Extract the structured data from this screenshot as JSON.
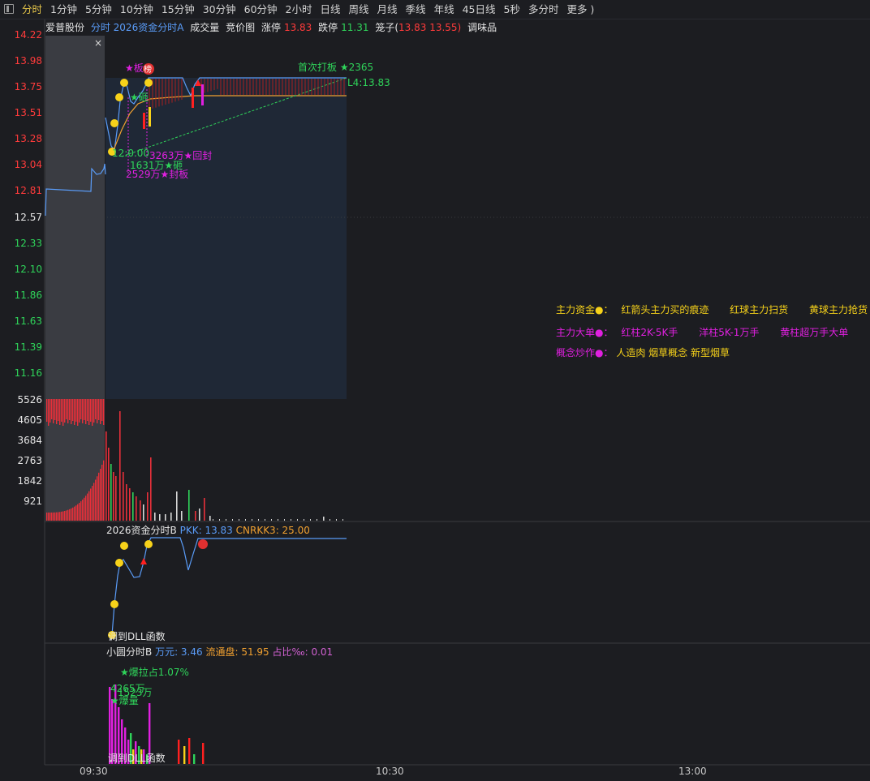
{
  "toolbar": {
    "tabs": [
      "分时",
      "1分钟",
      "5分钟",
      "10分钟",
      "15分钟",
      "30分钟",
      "60分钟",
      "2小时",
      "日线",
      "周线",
      "月线",
      "季线",
      "年线",
      "45日线",
      "5秒",
      "多分时",
      "更多 )"
    ],
    "active_tab": "分时"
  },
  "info": {
    "stock_name": "爱普股份",
    "indicator_a": "分时 2026资金分时A",
    "volume": "成交量",
    "auction": "竞价图",
    "limit_up_label": "涨停",
    "limit_up_value": "13.83",
    "limit_down_label": "跌停",
    "limit_down_value": "11.31",
    "cage_label": "笼子(",
    "cage_value": "13.83 13.55)",
    "taste": "调味品"
  },
  "price_axis": {
    "red_labels": [
      "14.22",
      "13.98",
      "13.75",
      "13.51",
      "13.28",
      "13.04",
      "12.81"
    ],
    "base_label": "12.57",
    "green_labels": [
      "12.33",
      "12.10",
      "11.86",
      "11.63",
      "11.39",
      "11.16"
    ]
  },
  "volume_axis": [
    "5526",
    "4605",
    "3684",
    "2763",
    "1842",
    "921"
  ],
  "annotations": {
    "board": "★板",
    "rank": "榜",
    "smash": "★砸",
    "first_board": "首次打板 ★2365",
    "l4": "L4:13.83",
    "time_mark": "12:0.00",
    "recap": "3263万★回封",
    "smash_amount": "1631万★砸",
    "seal_amount": "2529万★封板",
    "close": "×"
  },
  "legend": {
    "row1_label": "主力资金●：",
    "row1_a": "红箭头主力买的痕迹",
    "row1_b": "红球主力扫货",
    "row1_c": "黄球主力抢货",
    "row2_label": "主力大单●：",
    "row2_a": "红柱2K-5K手",
    "row2_b": "洋柱5K-1万手",
    "row2_c": "黄柱超万手大单",
    "row3_label": "概念炒作●：",
    "row3_a": "人造肉 烟草概念 新型烟草"
  },
  "panel_b": {
    "title": "2026资金分时B",
    "pkk": "PKK: 13.83",
    "cnrkk": "CNRKK3: 25.00",
    "footer": "调到DLL函数"
  },
  "panel_c": {
    "title": "小圆分时B",
    "wan": "万元: 3.46",
    "float": "流通盘: 51.95",
    "ratio": "占比‰: 0.01",
    "burst": "★爆拉占1.07%",
    "amt1": "4265万",
    "amt2": "1523万",
    "burst_vol": "★爆量",
    "footer": "调到DLL函数"
  },
  "time_axis": [
    "09:30",
    "10:30",
    "13:00"
  ],
  "colors": {
    "up": "#ff3b3b",
    "down": "#2fd45a",
    "price_line": "#5a9cf8",
    "avg_line": "#f0a030",
    "accent": "#e8c84a",
    "magenta": "#e020e0",
    "yellow": "#f7d21a"
  }
}
